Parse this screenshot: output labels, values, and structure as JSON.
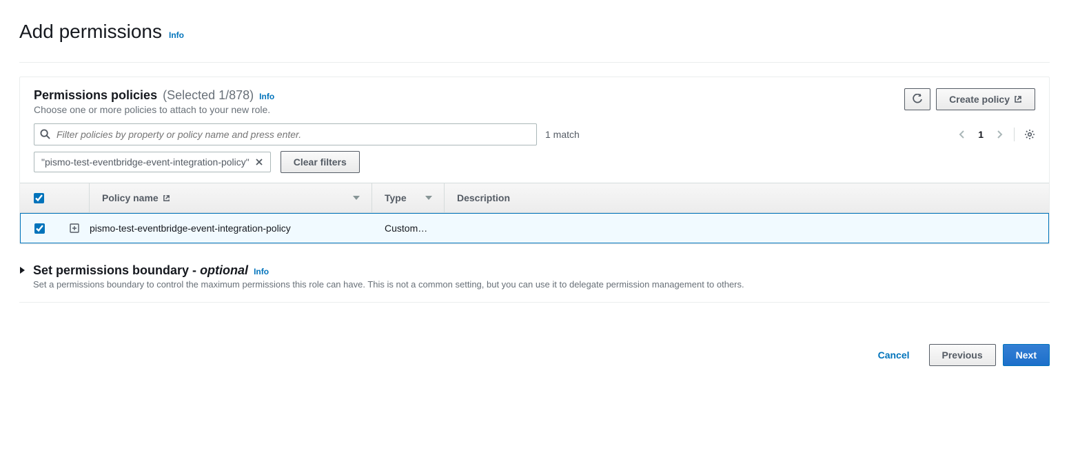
{
  "page": {
    "title": "Add permissions",
    "info": "Info"
  },
  "panel": {
    "title": "Permissions policies",
    "selected_text": "(Selected 1/878)",
    "info": "Info",
    "subtitle": "Choose one or more policies to attach to your new role.",
    "refresh_label": "Refresh",
    "create_policy_label": "Create policy"
  },
  "filter": {
    "placeholder": "Filter policies by property or policy name and press enter.",
    "match_text": "1 match",
    "page_num": "1",
    "token_text": "\"pismo-test-eventbridge-event-integration-policy\"",
    "clear_filters_label": "Clear filters"
  },
  "table": {
    "header_name": "Policy name",
    "header_type": "Type",
    "header_desc": "Description",
    "rows": [
      {
        "name": "pismo-test-eventbridge-event-integration-policy",
        "type": "Custom…",
        "description": ""
      }
    ]
  },
  "boundary": {
    "title": "Set permissions boundary - ",
    "optional": "optional",
    "info": "Info",
    "description": "Set a permissions boundary to control the maximum permissions this role can have. This is not a common setting, but you can use it to delegate permission management to others."
  },
  "footer": {
    "cancel": "Cancel",
    "previous": "Previous",
    "next": "Next"
  }
}
